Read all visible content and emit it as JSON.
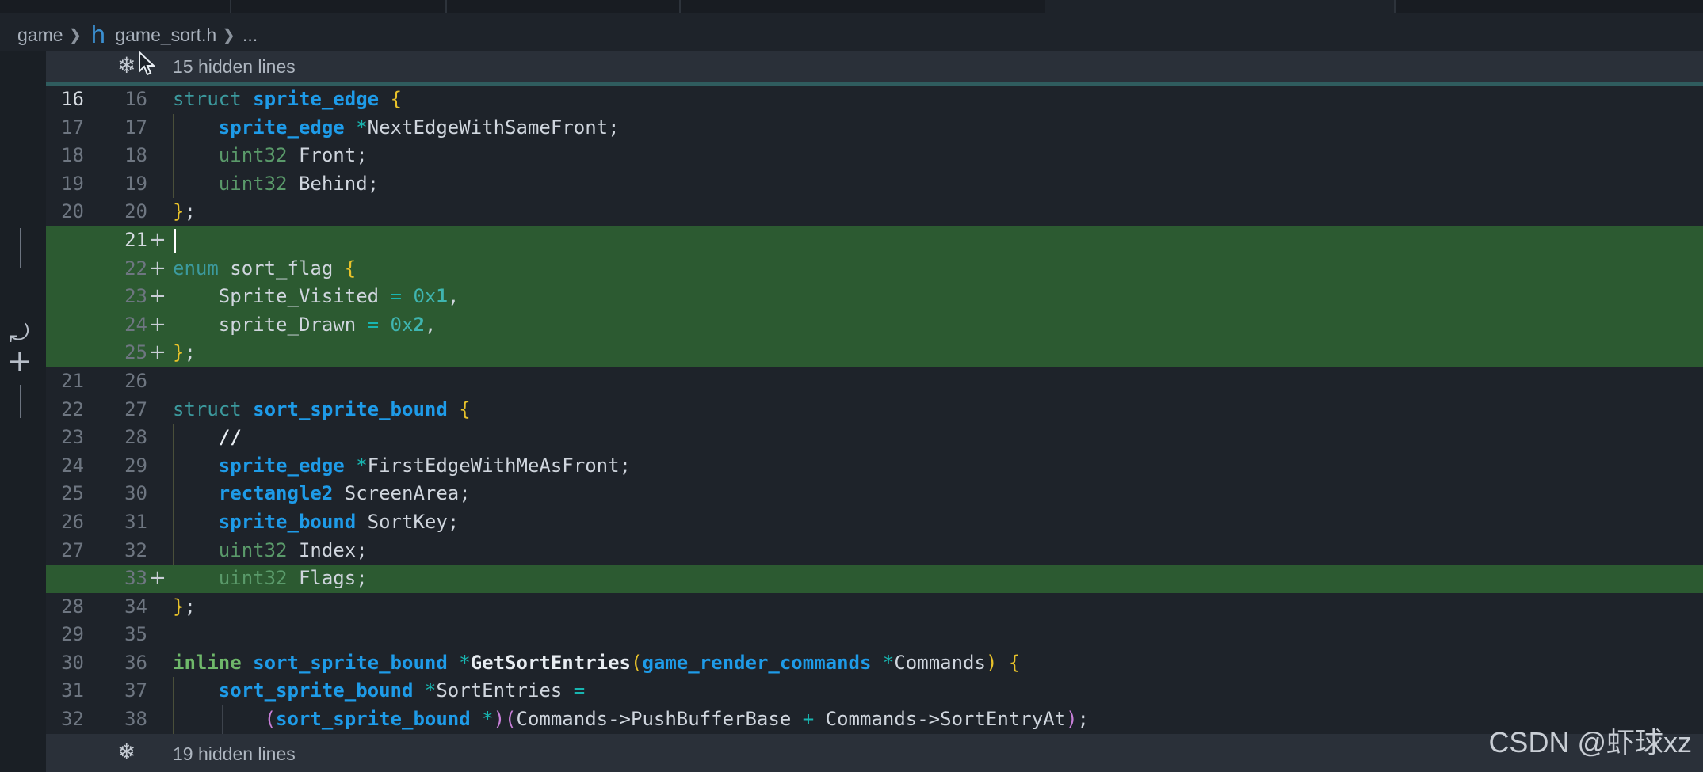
{
  "breadcrumb": {
    "items": [
      "game",
      "game_sort.h",
      "..."
    ]
  },
  "hidden_top": {
    "label": "15 hidden lines"
  },
  "hidden_bottom": {
    "label": "19 hidden lines"
  },
  "watermark": "CSDN @虾球xz",
  "lines": [
    {
      "old": "16",
      "new": "16",
      "added": false,
      "current": true
    },
    {
      "old": "17",
      "new": "17",
      "added": false
    },
    {
      "old": "18",
      "new": "18",
      "added": false
    },
    {
      "old": "19",
      "new": "19",
      "added": false
    },
    {
      "old": "20",
      "new": "20",
      "added": false
    },
    {
      "old": "",
      "new": "21",
      "added": true,
      "current_new": true
    },
    {
      "old": "",
      "new": "22",
      "added": true
    },
    {
      "old": "",
      "new": "23",
      "added": true
    },
    {
      "old": "",
      "new": "24",
      "added": true
    },
    {
      "old": "",
      "new": "25",
      "added": true
    },
    {
      "old": "21",
      "new": "26",
      "added": false
    },
    {
      "old": "22",
      "new": "27",
      "added": false
    },
    {
      "old": "23",
      "new": "28",
      "added": false
    },
    {
      "old": "24",
      "new": "29",
      "added": false
    },
    {
      "old": "25",
      "new": "30",
      "added": false
    },
    {
      "old": "26",
      "new": "31",
      "added": false
    },
    {
      "old": "27",
      "new": "32",
      "added": false
    },
    {
      "old": "",
      "new": "33",
      "added": true
    },
    {
      "old": "28",
      "new": "34",
      "added": false
    },
    {
      "old": "29",
      "new": "35",
      "added": false
    },
    {
      "old": "30",
      "new": "36",
      "added": false
    },
    {
      "old": "31",
      "new": "37",
      "added": false
    },
    {
      "old": "32",
      "new": "38",
      "added": false
    }
  ],
  "code": {
    "l16": [
      "struct",
      "sprite_edge",
      "{"
    ],
    "l17": [
      "sprite_edge",
      "*",
      "NextEdgeWithSameFront;"
    ],
    "l18": [
      "uint32",
      "Front;"
    ],
    "l19": [
      "uint32",
      "Behind;"
    ],
    "l20": [
      "}",
      ";"
    ],
    "l22": [
      "enum",
      "sort_flag",
      "{"
    ],
    "l23": [
      "Sprite_Visited",
      "=",
      "0x",
      "1",
      ","
    ],
    "l24": [
      "sprite_Drawn",
      "=",
      "0x",
      "2",
      ","
    ],
    "l25": [
      "}",
      ";"
    ],
    "l27": [
      "struct",
      "sort_sprite_bound",
      "{"
    ],
    "l28": [
      "//"
    ],
    "l29": [
      "sprite_edge",
      "*",
      "FirstEdgeWithMeAsFront;"
    ],
    "l30": [
      "rectangle2",
      "ScreenArea;"
    ],
    "l31": [
      "sprite_bound",
      "SortKey;"
    ],
    "l32": [
      "uint32",
      "Index;"
    ],
    "l33": [
      "uint32",
      "Flags;"
    ],
    "l34": [
      "}",
      ";"
    ],
    "l36": [
      "inline",
      "sort_sprite_bound",
      "*",
      "GetSortEntries",
      "(",
      "game_render_commands",
      "*",
      "Commands",
      ")",
      "{"
    ],
    "l37": [
      "sort_sprite_bound",
      "*",
      "SortEntries",
      "="
    ],
    "l38": [
      "(",
      "sort_sprite_bound",
      "*",
      ")",
      "(",
      "Commands->PushBufferBase",
      "+",
      "Commands->SortEntryAt",
      ")",
      ";"
    ]
  }
}
